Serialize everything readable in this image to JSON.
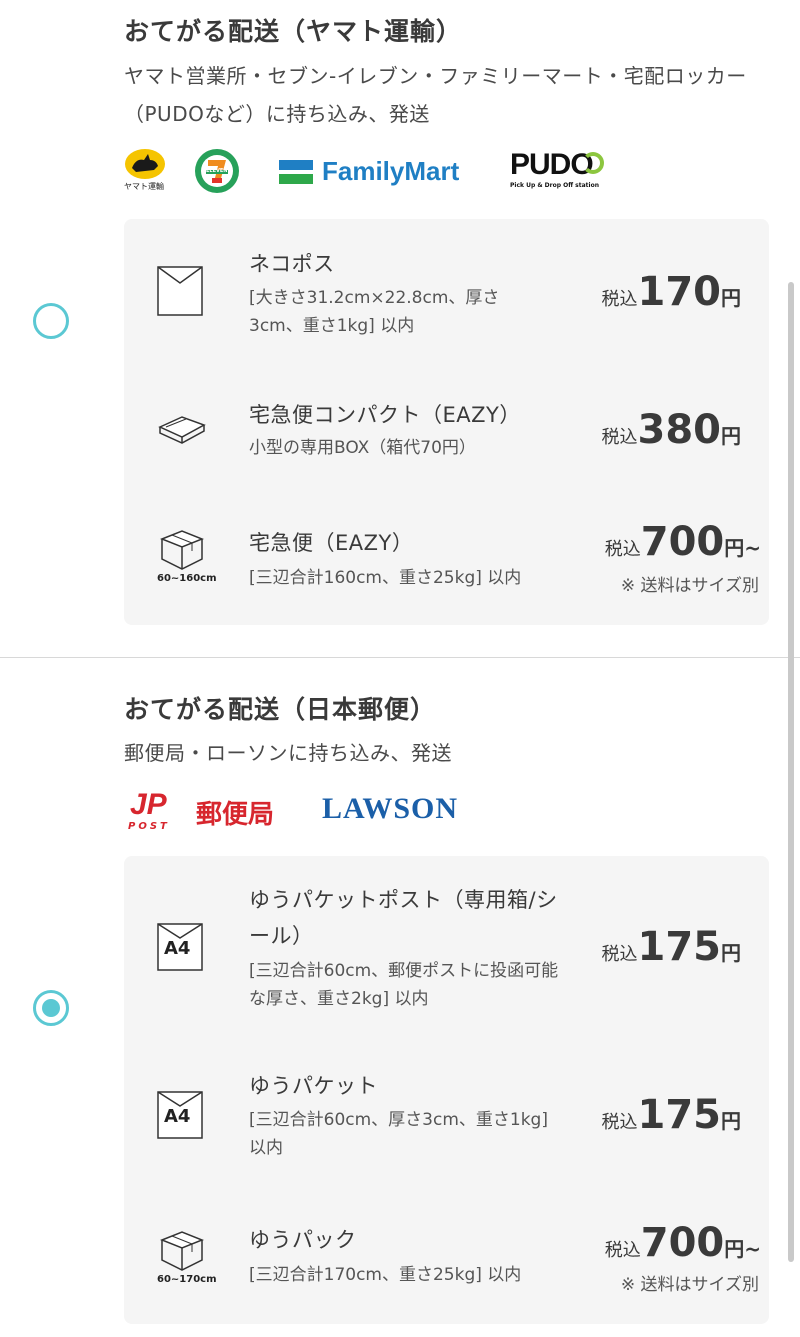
{
  "yamato": {
    "title": "おてがる配送（ヤマト運輸）",
    "description": "ヤマト営業所・セブン-イレブン・ファミリーマート・宅配ロッカー（PUDOなど）に持ち込み、発送",
    "logos": {
      "yamato_caption": "ヤマト運輸",
      "seven_text": "ELEVEN",
      "familymart": "FamilyMart",
      "pudo": "PUDO",
      "pudo_sub": "Pick Up & Drop Off station"
    },
    "options": [
      {
        "name": "ネコポス",
        "note": "[大きさ31.2cm×22.8cm、厚さ3cm、重さ1kg] 以内",
        "price_prefix": "税込",
        "price": "170",
        "price_suffix": "円"
      },
      {
        "name": "宅急便コンパクト（EAZY）",
        "note": "小型の専用BOX（箱代70円）",
        "price_prefix": "税込",
        "price": "380",
        "price_suffix": "円"
      },
      {
        "name": "宅急便（EAZY）",
        "note": "[三辺合計160cm、重さ25kg] 以内",
        "icon_label": "60~160cm",
        "price_prefix": "税込",
        "price": "700",
        "price_suffix": "円~",
        "price_note": "※ 送料はサイズ別"
      }
    ]
  },
  "japanpost": {
    "title": "おてがる配送（日本郵便）",
    "description": "郵便局・ローソンに持ち込み、発送",
    "logos": {
      "jp": "JP",
      "post": "POST",
      "yubinkyoku": "郵便局",
      "lawson": "LAWSON"
    },
    "options": [
      {
        "name": "ゆうパケットポスト（専用箱/シール）",
        "note": "[三辺合計60cm、郵便ポストに投函可能な厚さ、重さ2kg] 以内",
        "icon_label": "A4",
        "price_prefix": "税込",
        "price": "175",
        "price_suffix": "円"
      },
      {
        "name": "ゆうパケット",
        "note": "[三辺合計60cm、厚さ3cm、重さ1kg] 以内",
        "icon_label": "A4",
        "price_prefix": "税込",
        "price": "175",
        "price_suffix": "円"
      },
      {
        "name": "ゆうパック",
        "note": "[三辺合計170cm、重さ25kg] 以内",
        "icon_label": "60~170cm",
        "price_prefix": "税込",
        "price": "700",
        "price_suffix": "円~",
        "price_note": "※ 送料はサイズ別"
      }
    ]
  },
  "selection": {
    "yamato_selected": false,
    "japanpost_selected": true
  },
  "colors": {
    "accent": "#5bc8d3",
    "familymart_blue": "#1f7fc4",
    "familymart_green": "#2ea84a",
    "jp_red": "#d7262e",
    "lawson_blue": "#1b5fa8",
    "seven_green": "#27a15a",
    "seven_red": "#e4352a",
    "seven_orange": "#f08c1e"
  }
}
